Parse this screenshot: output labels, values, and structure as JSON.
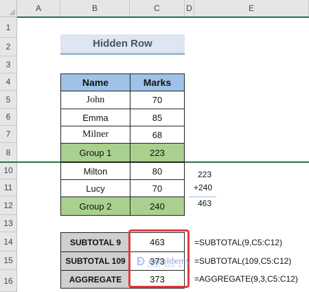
{
  "columns": [
    "A",
    "B",
    "C",
    "D",
    "E"
  ],
  "rows": [
    "1",
    "2",
    "3",
    "4",
    "5",
    "6",
    "7",
    "8",
    "10",
    "11",
    "12",
    "13",
    "14",
    "15",
    "16"
  ],
  "title": "Hidden Row",
  "table": {
    "headers": [
      "Name",
      "Marks"
    ],
    "rows": [
      {
        "name": "John",
        "marks": "70"
      },
      {
        "name": "Emma",
        "marks": "85"
      },
      {
        "name": "Milner",
        "marks": "68"
      },
      {
        "name": "Group 1",
        "marks": "223"
      },
      {
        "name": "Milton",
        "marks": "80"
      },
      {
        "name": "Lucy",
        "marks": "70"
      },
      {
        "name": "Group 2",
        "marks": "240"
      }
    ]
  },
  "side_sum": {
    "a": "223",
    "b": "+240",
    "total": "463"
  },
  "results": [
    {
      "label": "SUBTOTAL 9",
      "value": "463",
      "formula": "=SUBTOTAL(9,C5:C12)"
    },
    {
      "label": "SUBTOTAL 109",
      "value": "373",
      "formula": "=SUBTOTAL(109,C5:C12)"
    },
    {
      "label": "AGGREGATE",
      "value": "373",
      "formula": "=AGGREGATE(9,3,C5:C12)"
    }
  ],
  "watermark": {
    "name": "exceldemy",
    "sub": "EXCEL · DATA · BI"
  },
  "colors": {
    "header_fill": "#9fc3e8",
    "group_fill": "#a9d08e",
    "label_fill": "#d0cece",
    "highlight": "#e0393e",
    "hidden_row_line": "#217346"
  }
}
